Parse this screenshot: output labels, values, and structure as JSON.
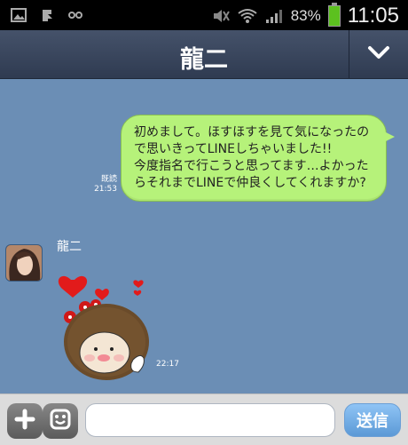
{
  "status_bar": {
    "battery_percent": "83%",
    "time": "11:05",
    "icons": [
      "image-icon",
      "download-icon",
      "link-icon",
      "mute-icon",
      "wifi-icon",
      "signal-icon",
      "battery-icon"
    ]
  },
  "header": {
    "title": "龍二",
    "menu_icon": "chevron-down-icon"
  },
  "messages": [
    {
      "type": "text",
      "direction": "outgoing",
      "lines": [
        "初めまして。ほすほすを見て気になったの",
        "で思いきってLINEしちゃいました!!",
        "今度指名で行こうと思ってます…よかった",
        "らそれまでLINEで仲良くしてくれますか?"
      ],
      "read_label": "既読",
      "time": "21:53"
    },
    {
      "type": "sticker",
      "direction": "incoming",
      "sender": "龍二",
      "time": "22:17"
    }
  ],
  "input_bar": {
    "placeholder": "",
    "send_label": "送信",
    "plus_icon": "plus-icon",
    "emoji_icon": "emoji-icon"
  }
}
